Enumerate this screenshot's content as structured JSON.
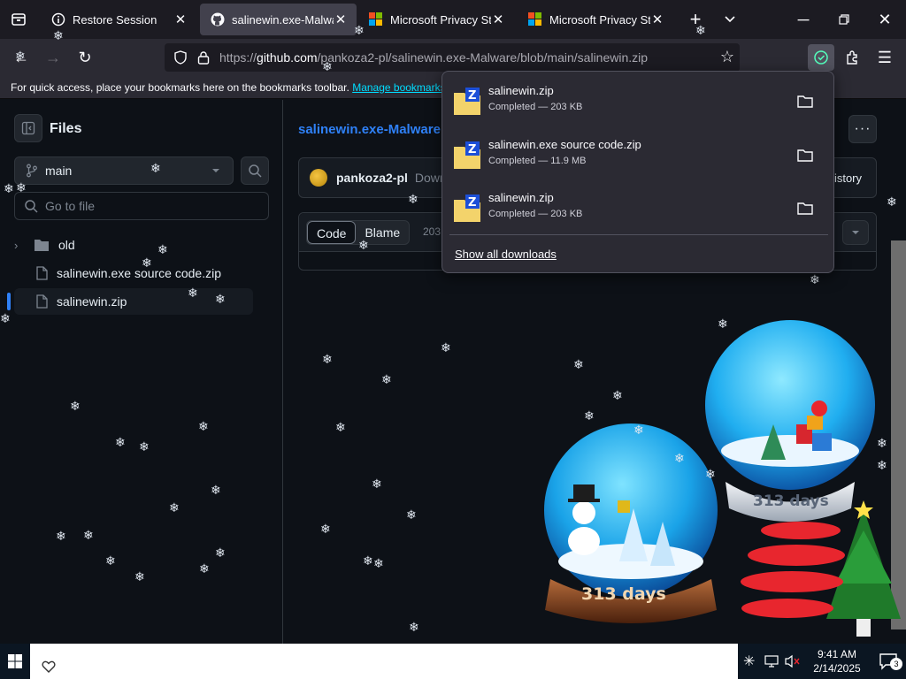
{
  "tabs": [
    {
      "label": "Restore Session",
      "icon": "info-icon",
      "active": false
    },
    {
      "label": "salinewin.exe-Malware",
      "icon": "github-icon",
      "active": true
    },
    {
      "label": "Microsoft Privacy State",
      "icon": "microsoft-icon",
      "active": false
    },
    {
      "label": "Microsoft Privacy State",
      "icon": "microsoft-icon",
      "active": false
    }
  ],
  "url": {
    "prefix": "https://",
    "host": "github.com",
    "path": "/pankoza2-pl/salinewin.exe-Malware/blob/main/salinewin.zip"
  },
  "bookmarks_bar": {
    "message": "For quick access, place your bookmarks here on the bookmarks toolbar.",
    "link": "Manage bookmarks"
  },
  "sidebar": {
    "title": "Files",
    "branch": "main",
    "goto_placeholder": "Go to file",
    "tree": [
      {
        "label": "old",
        "type": "folder"
      },
      {
        "label": "salinewin.exe source code.zip",
        "type": "file"
      },
      {
        "label": "salinewin.zip",
        "type": "file",
        "selected": true
      }
    ]
  },
  "main": {
    "repo_link": "salinewin.exe-Malware",
    "commit_author": "pankoza2-pl",
    "commit_message": "Down",
    "history_label": "istory",
    "view_tabs": [
      "Code",
      "Blame"
    ],
    "file_size": "203"
  },
  "downloads": {
    "items": [
      {
        "name": "salinewin.zip",
        "status": "Completed — 203 KB"
      },
      {
        "name": "salinewin.exe source code.zip",
        "status": "Completed — 11.9 MB"
      },
      {
        "name": "salinewin.zip",
        "status": "Completed — 203 KB"
      }
    ],
    "show_all": "Show all downloads"
  },
  "decorations": {
    "globe_left_text": "313 days",
    "globe_right_text": "313 days"
  },
  "taskbar": {
    "time": "9:41 AM",
    "date": "2/14/2025",
    "notification_count": "3"
  },
  "colors": {
    "accent_link": "#2f81f7",
    "browser_tab_bg": "#1c1b22",
    "page_bg": "#0d1117"
  }
}
